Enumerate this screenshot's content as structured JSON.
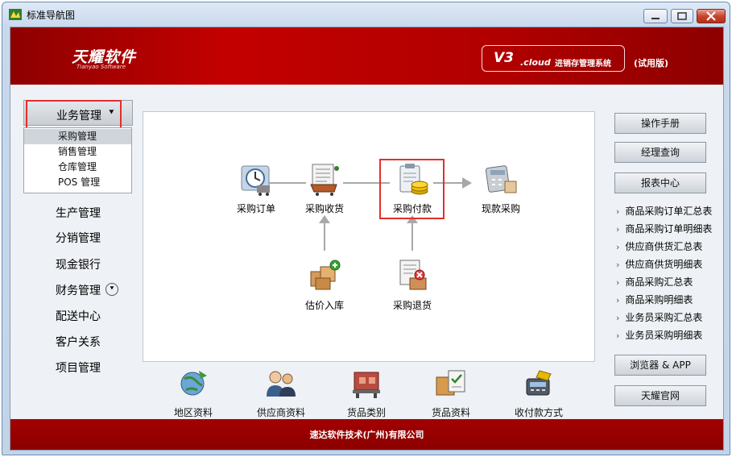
{
  "window": {
    "title": "标准导航图"
  },
  "header": {
    "logo_main": "天耀软件",
    "logo_sub": "Tianyao Software",
    "version_main": "V3",
    "version_cloud": ".cloud",
    "version_desc": "进销存管理系统",
    "trial": "(试用版)"
  },
  "sidebar": {
    "category": "业务管理",
    "sub_items": [
      "采购管理",
      "销售管理",
      "仓库管理",
      "POS 管理"
    ],
    "nav_items": [
      "生产管理",
      "分销管理",
      "现金银行",
      "财务管理",
      "配送中心",
      "客户关系",
      "项目管理"
    ]
  },
  "flow": {
    "purchase_order": "采购订单",
    "purchase_receive": "采购收货",
    "purchase_payment": "采购付款",
    "cash_purchase": "现款采购",
    "estimate_stock_in": "估价入库",
    "purchase_return": "采购退货"
  },
  "bottom": [
    "地区资料",
    "供应商资料",
    "货品类别",
    "货品资料",
    "收付款方式"
  ],
  "right_buttons": {
    "manual": "操作手册",
    "manager_query": "经理查询",
    "report_center": "报表中心",
    "browser_app": "浏览器 & APP",
    "official_site": "天耀官网"
  },
  "reports": [
    "商品采购订单汇总表",
    "商品采购订单明细表",
    "供应商供货汇总表",
    "供应商供货明细表",
    "商品采购汇总表",
    "商品采购明细表",
    "业务员采购汇总表",
    "业务员采购明细表"
  ],
  "footer": {
    "company": "速达软件技术(广州)有限公司"
  },
  "colors": {
    "header_red": "#b00000",
    "highlight": "#e0302a"
  }
}
